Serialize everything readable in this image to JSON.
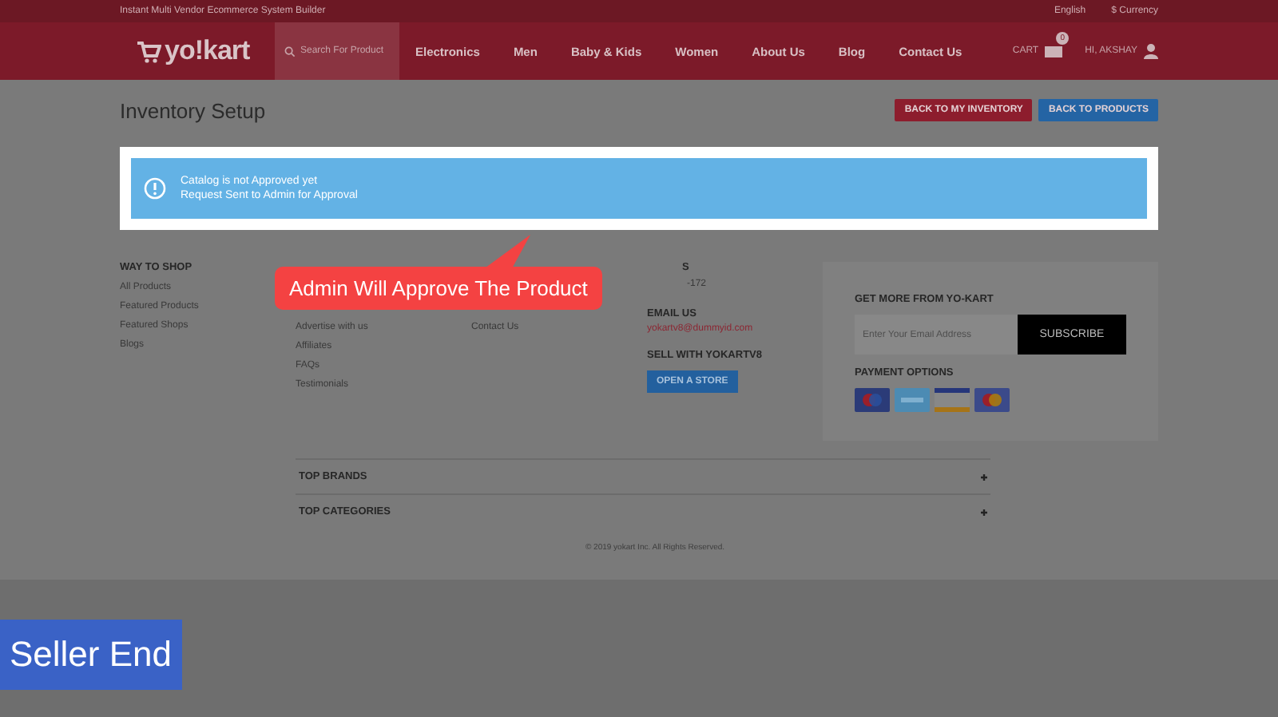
{
  "logo": {
    "text": "yo!kart"
  },
  "top_bar": {
    "tagline": "Instant Multi Vendor Ecommerce System Builder",
    "language": "English",
    "currency": "$ Currency"
  },
  "nav": {
    "search_placeholder": "Search For Product",
    "links": [
      "Electronics",
      "Men",
      "Baby & Kids",
      "Women",
      "About Us",
      "Blog",
      "Contact Us"
    ],
    "cart_label": "CART",
    "cart_count": "0",
    "user_greeting": "HI, AKSHAY"
  },
  "page": {
    "title": "Inventory Setup",
    "buttons": [
      {
        "label": "BACK TO MY INVENTORY",
        "kind": "danger"
      },
      {
        "label": "BACK TO PRODUCTS",
        "kind": "primary"
      }
    ]
  },
  "alert": {
    "lines": [
      "Catalog is not Approved yet",
      "Request Sent to Admin for Approval"
    ]
  },
  "callout": {
    "text": "Admin Will Approve The Product"
  },
  "footer": {
    "way_to_shop": {
      "heading": "WAY TO SHOP",
      "links": [
        "All Products",
        "Featured Products",
        "Featured Shops",
        "Blogs"
      ]
    },
    "column_2": {
      "links": [
        "Advertise with us",
        "Affiliates",
        "FAQs",
        "Testimonials"
      ]
    },
    "column_3": {
      "links": [
        "Contact Us"
      ]
    },
    "column_4": {
      "partial_heading": "S",
      "partial_text": "-172",
      "email_heading": "EMAIL US",
      "email": "yokartv8@dummyid.com",
      "sell_heading": "SELL WITH YOKARTV8",
      "store_button": "OPEN A STORE"
    },
    "newsletter": {
      "heading": "GET MORE FROM YO-KART",
      "placeholder": "Enter Your Email Address",
      "button": "SUBSCRIBE"
    },
    "payment": {
      "heading": "PAYMENT OPTIONS"
    },
    "accordions": [
      {
        "label": "TOP BRANDS",
        "expanded": false
      },
      {
        "label": "TOP CATEGORIES",
        "expanded": false
      }
    ],
    "copyright": "© 2019 yokart Inc. All Rights Reserved."
  },
  "badge": {
    "text": "Seller End"
  }
}
